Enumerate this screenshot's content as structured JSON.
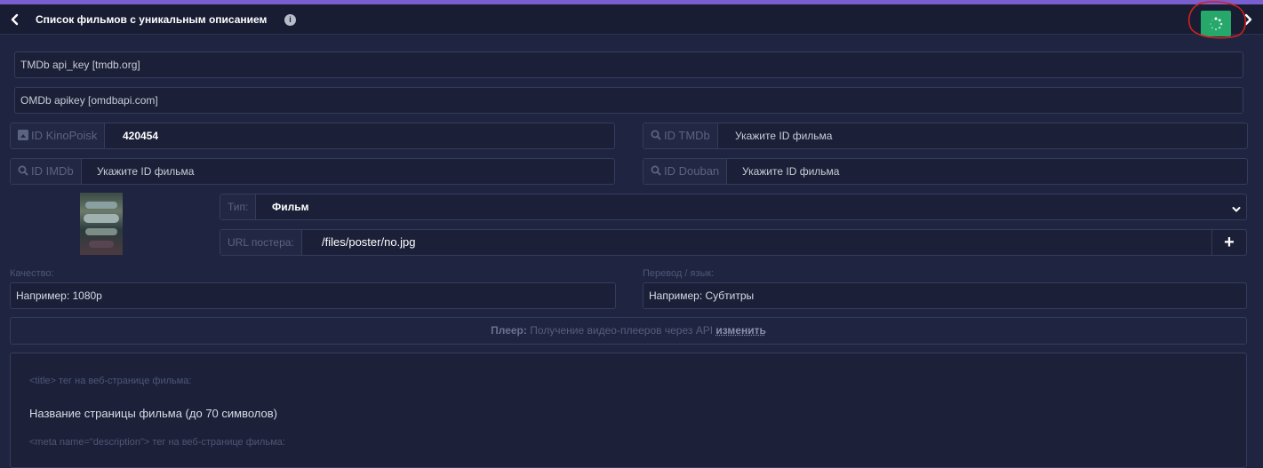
{
  "header": {
    "title": "Список фильмов с уникальным описанием",
    "info_icon": "i"
  },
  "api": {
    "tmdb_placeholder": "TMDb api_key [tmdb.org]",
    "omdb_placeholder": "OMDb apikey [omdbapi.com]"
  },
  "ids": {
    "kinopoisk_label": "ID KinoPoisk",
    "kinopoisk_value": "420454",
    "tmdb_label": "ID TMDb",
    "tmdb_placeholder": "Укажите ID фильма",
    "imdb_label": "ID IMDb",
    "imdb_placeholder": "Укажите ID фильма",
    "douban_label": "ID Douban",
    "douban_placeholder": "Укажите ID фильма"
  },
  "type": {
    "label": "Тип:",
    "selected": "Фильм"
  },
  "poster": {
    "label": "URL постера:",
    "value": "/files/poster/no.jpg",
    "add_label": "+"
  },
  "quality": {
    "label": "Качество:",
    "placeholder": "Например: 1080p"
  },
  "translation": {
    "label": "Перевод / язык:",
    "placeholder": "Например: Субтитры"
  },
  "player": {
    "label": "Плеер:",
    "text": "Получение видео-плееров через API",
    "change": "изменить"
  },
  "seo": {
    "title_label": "<title> тег на веб-странице фильма:",
    "title_placeholder": "Название страницы фильма (до 70 символов)",
    "description_label": "<meta name=\"description\"> тег на веб-странице фильма:"
  },
  "colors": {
    "accent": "#7a5fd0",
    "spin_button": "#25a86a",
    "annotation": "#d42020"
  },
  "icons": {
    "back": "chevron-left-icon",
    "info": "info-icon",
    "spinner": "spinner-icon",
    "forward": "chevron-right-icon",
    "kinopoisk": "image-icon",
    "search": "search-icon",
    "select": "chevron-down-icon",
    "add": "plus-icon"
  }
}
